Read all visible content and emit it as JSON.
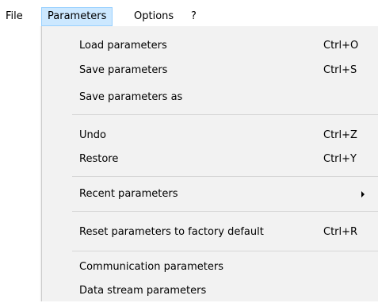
{
  "menubar": {
    "items": [
      {
        "label": "File"
      },
      {
        "label": "Parameters"
      },
      {
        "label": "Options"
      },
      {
        "label": "?"
      }
    ]
  },
  "dropdown": {
    "items": [
      {
        "label": "Load parameters",
        "shortcut": "Ctrl+O"
      },
      {
        "label": "Save parameters",
        "shortcut": "Ctrl+S"
      },
      {
        "label": "Save parameters as",
        "shortcut": ""
      },
      {
        "label": "Undo",
        "shortcut": "Ctrl+Z"
      },
      {
        "label": "Restore",
        "shortcut": "Ctrl+Y"
      },
      {
        "label": "Recent parameters",
        "shortcut": ""
      },
      {
        "label": "Reset parameters to factory default",
        "shortcut": "Ctrl+R"
      },
      {
        "label": "Communication parameters",
        "shortcut": ""
      },
      {
        "label": "Data stream parameters",
        "shortcut": ""
      }
    ],
    "submenu_icon": "submenu-arrow-icon"
  },
  "colors": {
    "menu_background": "#f2f2f2",
    "active_menubar_background": "#cce8ff",
    "active_menubar_border": "#99d1ff",
    "separator": "#d7d7d7"
  }
}
